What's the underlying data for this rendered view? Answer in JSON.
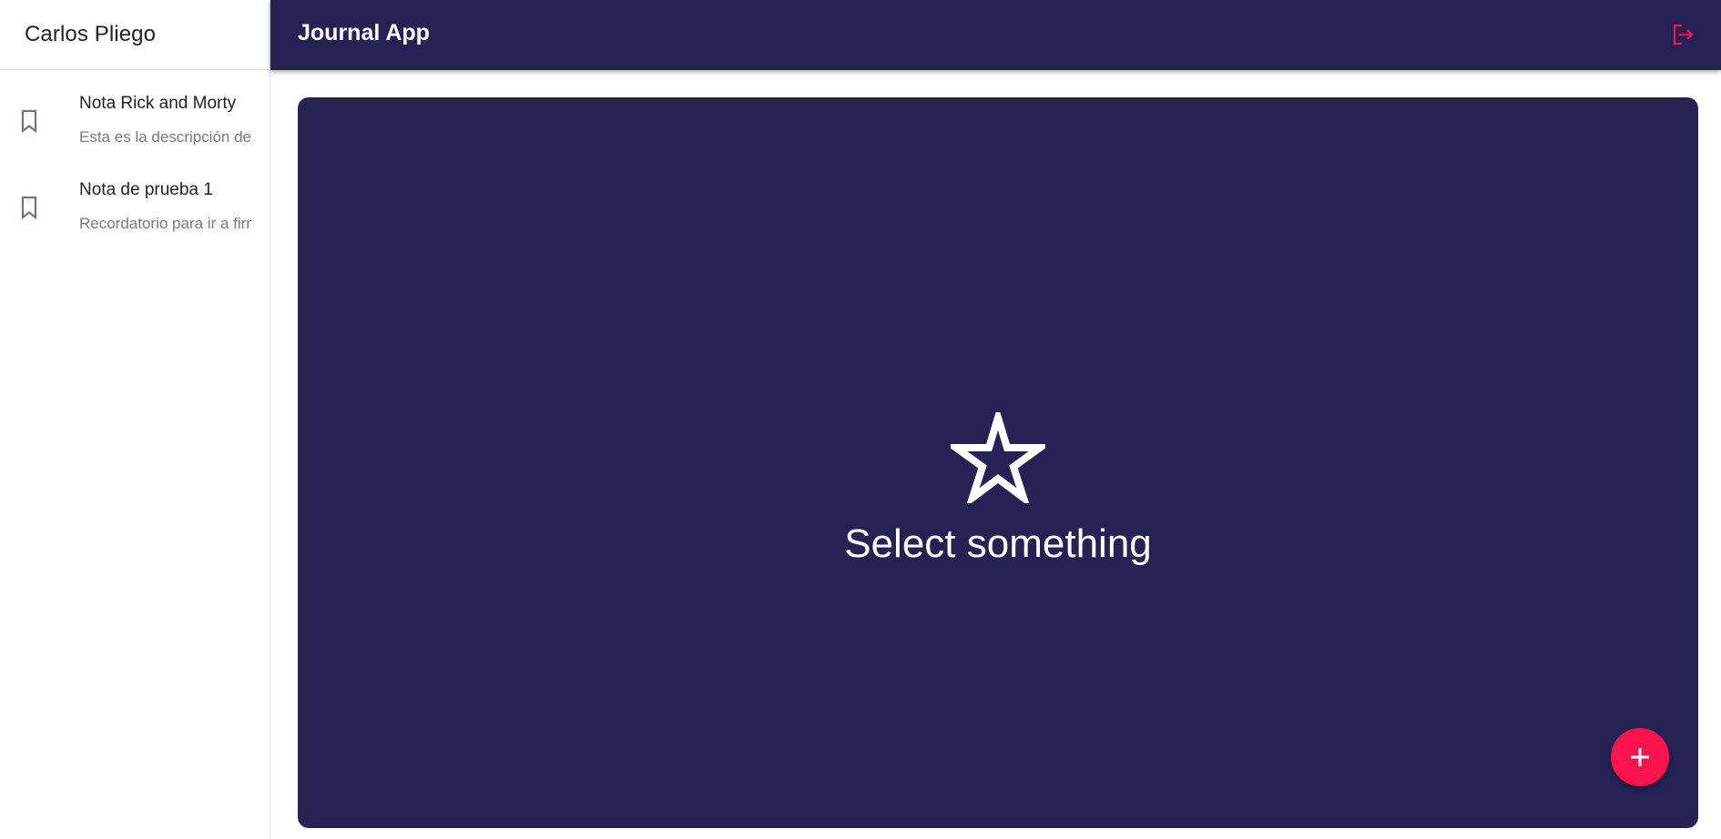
{
  "sidebar": {
    "user_name": "Carlos Pliego",
    "notes": [
      {
        "title": "Nota Rick and Morty",
        "body": "Esta es la descripción de la nota"
      },
      {
        "title": "Nota de prueba 1",
        "body": "Recordatorio para ir a firmar"
      }
    ]
  },
  "appbar": {
    "title": "Journal App",
    "logout_icon": "logout-icon"
  },
  "main": {
    "empty_icon": "star-outline-icon",
    "empty_text": "Select something"
  },
  "fab": {
    "icon": "add-icon"
  },
  "colors": {
    "primary": "#262254",
    "accent": "#fc1450",
    "sidebar_bg": "#ffffff"
  }
}
